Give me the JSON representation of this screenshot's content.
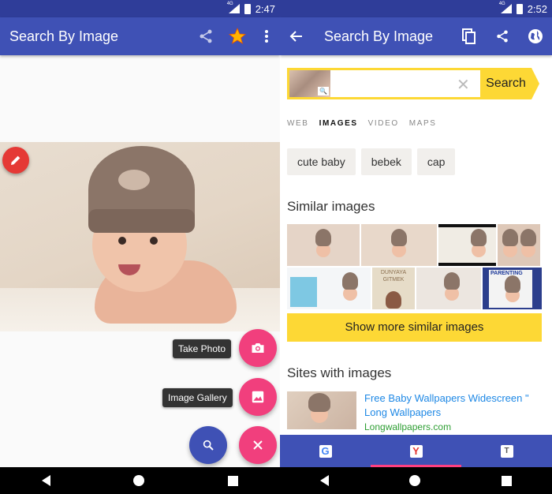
{
  "left": {
    "status": {
      "time": "2:47",
      "network": "4G"
    },
    "appbar": {
      "title": "Search By Image",
      "icons": [
        "share-icon",
        "star-icon",
        "more-vert-icon"
      ]
    },
    "fab_menu": {
      "take_photo_label": "Take Photo",
      "image_gallery_label": "Image Gallery"
    },
    "colors": {
      "primary": "#3f51b5",
      "accent": "#f13f7d",
      "edit": "#e53935"
    }
  },
  "right": {
    "status": {
      "time": "2:52",
      "network": "4G"
    },
    "appbar": {
      "title": "Search By Image",
      "icons": [
        "back-arrow-icon",
        "copy-icon",
        "share-icon",
        "globe-icon"
      ]
    },
    "search": {
      "value": "",
      "button_label": "Search"
    },
    "tabs": [
      {
        "label": "WEB",
        "active": false
      },
      {
        "label": "IMAGES",
        "active": true
      },
      {
        "label": "VIDEO",
        "active": false
      },
      {
        "label": "MAPS",
        "active": false
      }
    ],
    "chips": [
      "cute baby",
      "bebek",
      "cap"
    ],
    "similar": {
      "title": "Similar images",
      "row1": [
        "baby photo",
        "baby photo",
        "urdu text baby",
        "twin baby"
      ],
      "row2": [
        "pampers ad baby",
        "dunyaya gitmek book",
        "baby on blanket",
        "parenting magazine"
      ],
      "book_text": "DUNYAYA GITMEK",
      "magazine_text": "PARENTING",
      "more_label": "Show more similar images"
    },
    "sites": {
      "title": "Sites with images",
      "items": [
        {
          "title": "Free Baby Wallpapers Widescreen \" Long Wallpapers",
          "url": "Longwallpapers.com"
        }
      ]
    },
    "bottom_tabs": [
      {
        "name": "google",
        "glyph": "G",
        "active": false
      },
      {
        "name": "yandex",
        "glyph": "Y",
        "active": true
      },
      {
        "name": "tineye",
        "glyph": "T",
        "active": false
      }
    ],
    "colors": {
      "search_yellow": "#fdd835",
      "link": "#1e88e5",
      "url": "#2e9e33",
      "tab_indicator": "#ff4081"
    }
  }
}
